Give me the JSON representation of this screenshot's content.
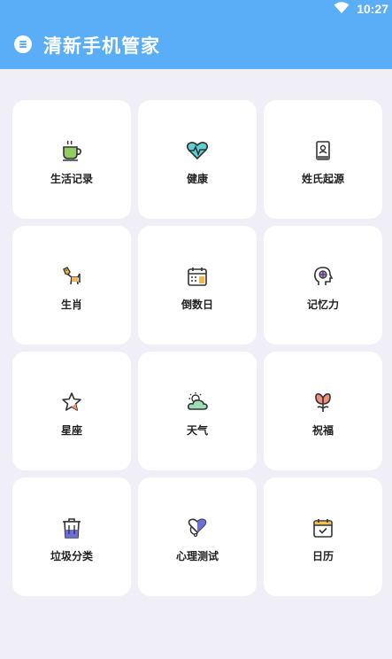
{
  "status_bar": {
    "time": "10:27",
    "wifi_icon": "wifi-icon"
  },
  "app_bar": {
    "title": "清新手机管家",
    "menu_icon": "menu-icon",
    "color": "#5aaef7"
  },
  "background_color": "#f0eff8",
  "tiles": [
    {
      "label": "生活记录",
      "icon": "teacup-icon"
    },
    {
      "label": "健康",
      "icon": "heart-pulse-icon"
    },
    {
      "label": "姓氏起源",
      "icon": "book-icon"
    },
    {
      "label": "生肖",
      "icon": "dog-icon"
    },
    {
      "label": "倒数日",
      "icon": "calendar-countdown-icon"
    },
    {
      "label": "记忆力",
      "icon": "brain-head-icon"
    },
    {
      "label": "星座",
      "icon": "star-icon"
    },
    {
      "label": "天气",
      "icon": "cloud-sun-icon"
    },
    {
      "label": "祝福",
      "icon": "tulip-icon"
    },
    {
      "label": "垃圾分类",
      "icon": "trash-bin-icon"
    },
    {
      "label": "心理测试",
      "icon": "heart-stethoscope-icon"
    },
    {
      "label": "日历",
      "icon": "calendar-check-icon"
    }
  ]
}
